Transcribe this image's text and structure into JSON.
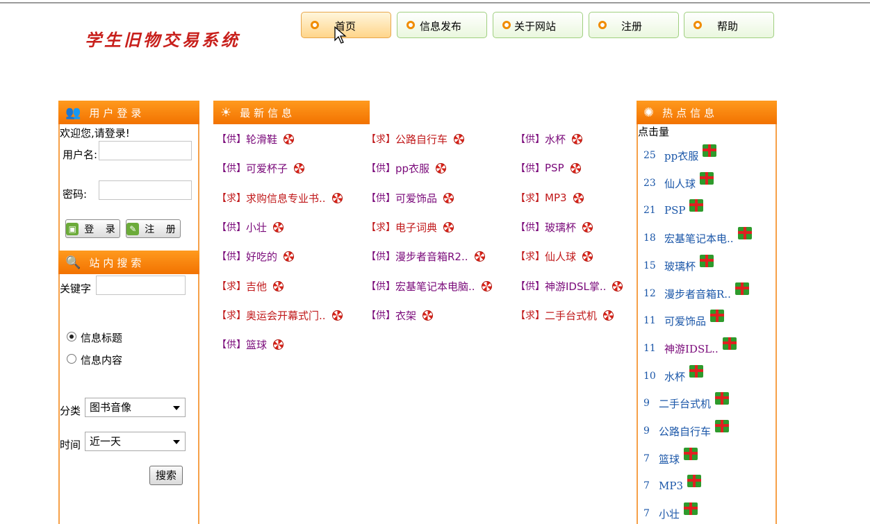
{
  "logo": "学生旧物交易系统",
  "nav": [
    "首页",
    "信息发布",
    "关于网站",
    "注册",
    "帮助"
  ],
  "login": {
    "title": "用户登录",
    "welcome": "欢迎您,请登录!",
    "username_label": "用户名:",
    "password_label": "密码:",
    "login_btn": "登 录",
    "register_btn": "注 册"
  },
  "search": {
    "title": "站内搜索",
    "keyword_label": "关键字",
    "option_title": "信息标题",
    "option_content": "信息内容",
    "category_label": "分类",
    "category_value": "图书音像",
    "time_label": "时间",
    "time_value": "近一天",
    "search_btn": "搜索"
  },
  "latest": {
    "title": "最新信息",
    "items": [
      {
        "tag": "【供】",
        "text": "轮滑鞋"
      },
      {
        "tag": "【求】",
        "text": "公路自行车"
      },
      {
        "tag": "【供】",
        "text": "水杯"
      },
      {
        "tag": "【供】",
        "text": "可爱杯子"
      },
      {
        "tag": "【供】",
        "text": "pp衣服"
      },
      {
        "tag": "【供】",
        "text": "PSP"
      },
      {
        "tag": "【求】",
        "text": "求购信息专业书.."
      },
      {
        "tag": "【供】",
        "text": "可爱饰品"
      },
      {
        "tag": "【求】",
        "text": "MP3"
      },
      {
        "tag": "【供】",
        "text": "小壮"
      },
      {
        "tag": "【求】",
        "text": "电子词典"
      },
      {
        "tag": "【供】",
        "text": "玻璃杯"
      },
      {
        "tag": "【供】",
        "text": "好吃的"
      },
      {
        "tag": "【供】",
        "text": "漫步者音箱R2.."
      },
      {
        "tag": "【求】",
        "text": "仙人球"
      },
      {
        "tag": "【求】",
        "text": "吉他"
      },
      {
        "tag": "【供】",
        "text": "宏基笔记本电脑.."
      },
      {
        "tag": "【供】",
        "text": "神游IDSL掌.."
      },
      {
        "tag": "【求】",
        "text": "奥运会开幕式门.."
      },
      {
        "tag": "【供】",
        "text": "衣架"
      },
      {
        "tag": "【求】",
        "text": "二手台式机"
      },
      {
        "tag": "【供】",
        "text": "篮球"
      }
    ]
  },
  "hot": {
    "title": "热点信息",
    "subtitle": "点击量",
    "items": [
      {
        "count": "25",
        "name": "pp衣服"
      },
      {
        "count": "23",
        "name": "仙人球"
      },
      {
        "count": "21",
        "name": "PSP"
      },
      {
        "count": "18",
        "name": "宏基笔记本电.."
      },
      {
        "count": "15",
        "name": "玻璃杯"
      },
      {
        "count": "12",
        "name": "漫步者音箱R.."
      },
      {
        "count": "11",
        "name": "可爱饰品"
      },
      {
        "count": "11",
        "name": "神游IDSL.."
      },
      {
        "count": "10",
        "name": "水杯"
      },
      {
        "count": "9",
        "name": "二手台式机"
      },
      {
        "count": "9",
        "name": "公路自行车"
      },
      {
        "count": "7",
        "name": "篮球"
      },
      {
        "count": "7",
        "name": "MP3"
      },
      {
        "count": "7",
        "name": "小壮"
      }
    ]
  },
  "colors": {
    "accent_orange": "#f27200",
    "tag_supply": "#7a0a7a",
    "tag_request": "#c0181a",
    "link_blue": "#1a56a8"
  }
}
